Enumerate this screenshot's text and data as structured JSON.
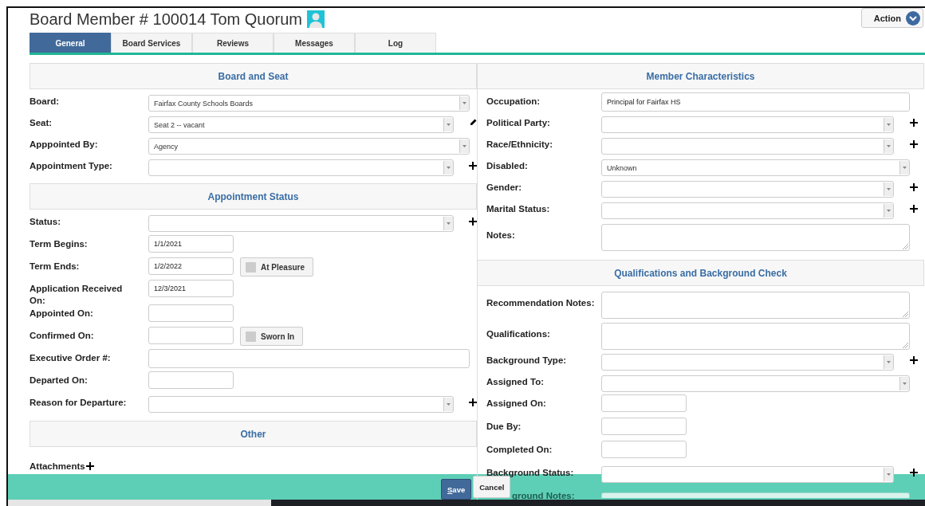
{
  "page": {
    "title": "Board Member # 100014 Tom Quorum"
  },
  "action_button": {
    "label": "Action"
  },
  "tabs": [
    {
      "label": "General",
      "selected": true
    },
    {
      "label": "Board Services",
      "selected": false
    },
    {
      "label": "Reviews",
      "selected": false
    },
    {
      "label": "Messages",
      "selected": false
    },
    {
      "label": "Log",
      "selected": false
    }
  ],
  "left_sections": [
    {
      "heading": "Board and Seat",
      "fields": [
        {
          "label": "Board:",
          "kind": "select",
          "value": "Fairfax County Schools Boards"
        },
        {
          "label": "Seat:",
          "kind": "select",
          "value": "Seat 2 -- vacant",
          "edit_button": true
        },
        {
          "label": "Apppointed By:",
          "kind": "select",
          "value": "Agency"
        },
        {
          "label": "Appointment Type:",
          "kind": "select",
          "add_button": true
        }
      ]
    },
    {
      "heading": "Appointment Status",
      "fields": [
        {
          "label": "Status:",
          "kind": "select",
          "add_button": true
        },
        {
          "label": "Term Begins:",
          "kind": "date",
          "value": "1/1/2021"
        },
        {
          "label": "Term Ends:",
          "kind": "date",
          "value": "1/2/2022",
          "toggle": {
            "label": "At Pleasure",
            "checked": false
          }
        },
        {
          "label": "Application Received On:",
          "kind": "date",
          "value": "12/3/2021"
        },
        {
          "label": "Appointed On:",
          "kind": "date"
        },
        {
          "label": "Confirmed On:",
          "kind": "date",
          "toggle": {
            "label": "Sworn In",
            "checked": false
          }
        },
        {
          "label": "Executive Order #:",
          "kind": "text"
        },
        {
          "label": "Departed On:",
          "kind": "date"
        },
        {
          "label": "Reason for Departure:",
          "kind": "select",
          "add_button": true
        }
      ]
    },
    {
      "heading": "Other",
      "fields": [
        {
          "label": "Attachments",
          "kind": "attachments"
        }
      ]
    }
  ],
  "right_sections": [
    {
      "heading": "Member Characteristics",
      "fields": [
        {
          "label": "Occupation:",
          "kind": "text",
          "value": "Principal for Fairfax HS"
        },
        {
          "label": "Political Party:",
          "kind": "select",
          "add_button": true
        },
        {
          "label": "Race/Ethnicity:",
          "kind": "select",
          "add_button": true
        },
        {
          "label": "Disabled:",
          "kind": "select",
          "value": "Unknown"
        },
        {
          "label": "Gender:",
          "kind": "select",
          "add_button": true
        },
        {
          "label": "Marital Status:",
          "kind": "select",
          "add_button": true
        },
        {
          "label": "Notes:",
          "kind": "textarea"
        }
      ]
    },
    {
      "heading": "Qualifications and Background Check",
      "fields": [
        {
          "label": "Recommendation Notes:",
          "kind": "textarea"
        },
        {
          "label": "Qualifications:",
          "kind": "textarea"
        },
        {
          "label": "Background Type:",
          "kind": "select",
          "add_button": true
        },
        {
          "label": "Assigned To:",
          "kind": "select"
        },
        {
          "label": "Assigned On:",
          "kind": "date"
        },
        {
          "label": "Due By:",
          "kind": "date"
        },
        {
          "label": "Completed On:",
          "kind": "date"
        },
        {
          "label": "Background Status:",
          "kind": "select",
          "add_button": true
        },
        {
          "label": "ground Notes:",
          "kind": "partial"
        }
      ]
    }
  ],
  "footer": {
    "buttons": [
      {
        "label": "Save",
        "kind": "primary"
      },
      {
        "label": "Cancel",
        "kind": "secondary"
      }
    ]
  }
}
